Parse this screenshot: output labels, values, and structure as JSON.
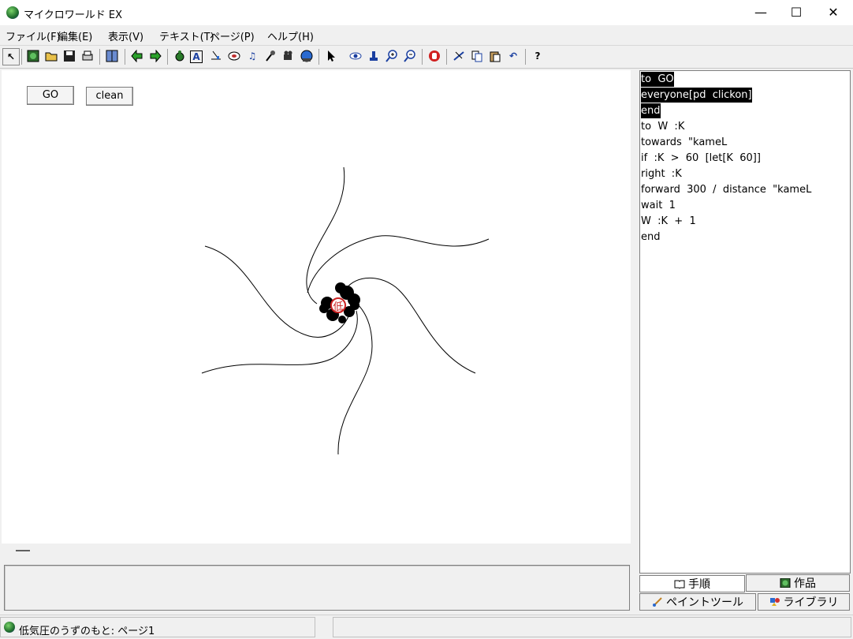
{
  "window": {
    "title": "マイクロワールド EX",
    "minimize": "—",
    "maximize": "☐",
    "close": "✕"
  },
  "menu": [
    "ファイル(F)",
    "編集(E)",
    "表示(V)",
    "テキスト(T)",
    "ページ(P)",
    "ヘルプ(H)"
  ],
  "canvas_buttons": {
    "go": "GO",
    "clean": "clean"
  },
  "turtle_label": "低",
  "script": [
    "to  GO",
    "everyone[pd  clickon]",
    "end",
    "to  W  :K",
    "towards  \"kameL",
    "if  :K  >  60  [let[K  60]]",
    "right  :K",
    "forward  300  /  distance  \"kameL",
    "wait  1",
    "W  :K  +  1",
    "end"
  ],
  "selected_script_lines": 3,
  "tabs": {
    "procedures": "手順",
    "works": "作品",
    "paint": "ペイントツール",
    "library": "ライブラリ"
  },
  "status": {
    "page_text": "低気圧のうずのもと: ページ1"
  },
  "colors": {
    "selection": "#000000",
    "turtle_center": "#cc2222"
  }
}
